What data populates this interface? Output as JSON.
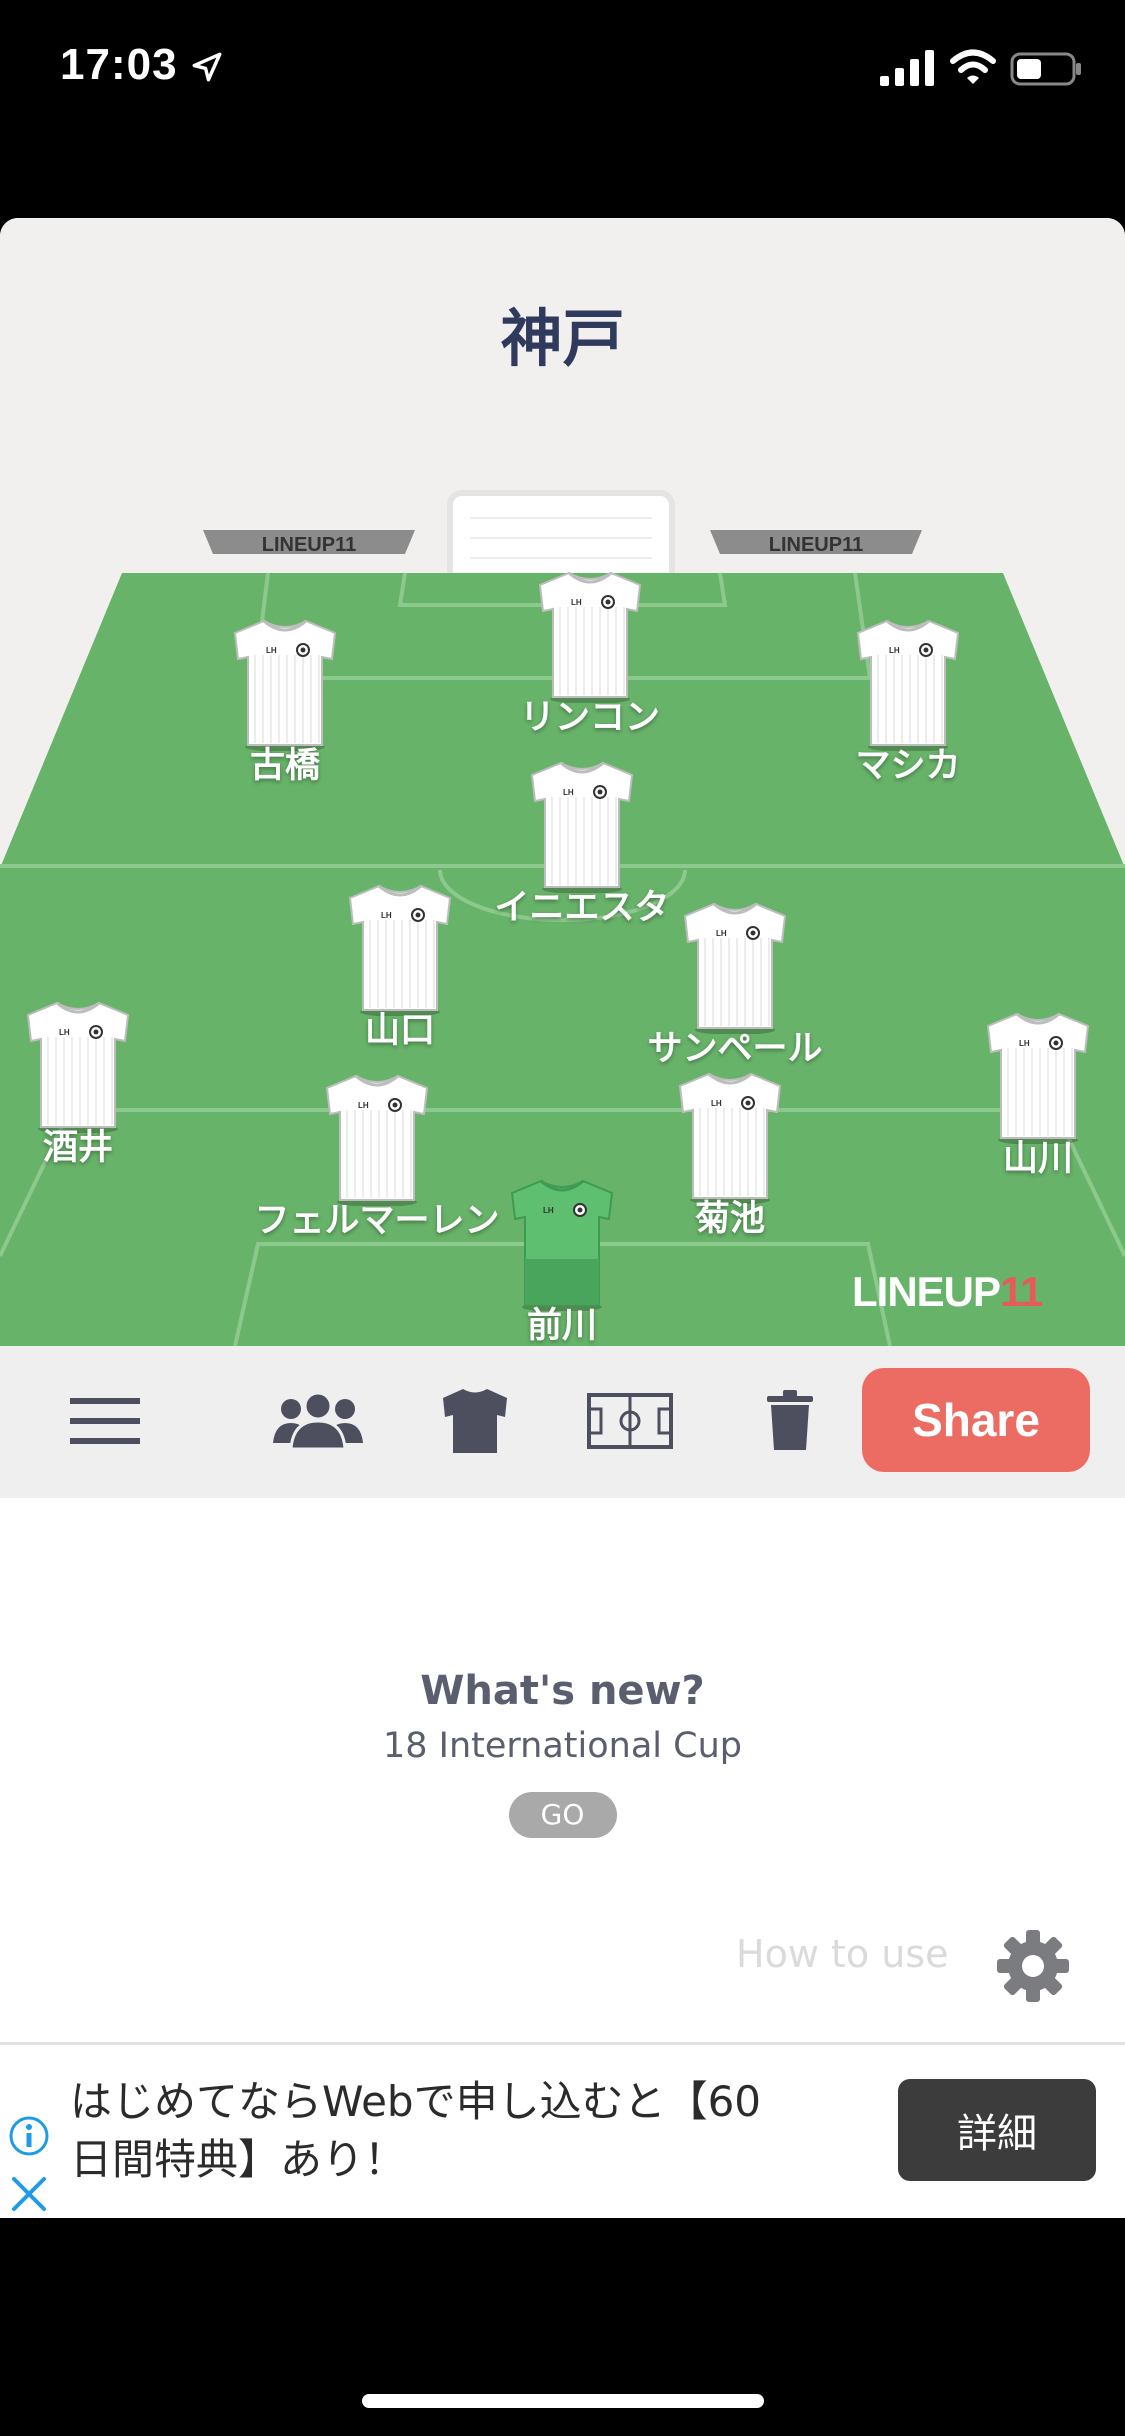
{
  "status_bar": {
    "time": "17:03"
  },
  "team": {
    "title": "神戸"
  },
  "banners": {
    "text": "LINEUP11"
  },
  "watermark": {
    "part1": "LINEUP",
    "part2": "11"
  },
  "players": [
    {
      "name": "リンコン",
      "kit": "outfield"
    },
    {
      "name": "古橋",
      "kit": "outfield"
    },
    {
      "name": "マシカ",
      "kit": "outfield"
    },
    {
      "name": "イニエスタ",
      "kit": "outfield"
    },
    {
      "name": "山口",
      "kit": "outfield"
    },
    {
      "name": "サンペール",
      "kit": "outfield"
    },
    {
      "name": "酒井",
      "kit": "outfield"
    },
    {
      "name": "山川",
      "kit": "outfield"
    },
    {
      "name": "フェルマーレン",
      "kit": "outfield"
    },
    {
      "name": "菊池",
      "kit": "outfield"
    },
    {
      "name": "前川",
      "kit": "goalkeeper"
    }
  ],
  "toolbar": {
    "menu_icon": "hamburger-icon",
    "players_icon": "group-icon",
    "kit_icon": "shirt-icon",
    "field_icon": "pitch-icon",
    "delete_icon": "trash-icon",
    "share_label": "Share"
  },
  "news": {
    "title": "What's new?",
    "subtitle": "18 International Cup",
    "go_label": "GO"
  },
  "help": {
    "label": "How to use"
  },
  "ad": {
    "text_line1": "はじめてならWebで申し込むと【60",
    "text_line2": "日間特典】あり！",
    "button_label": "詳細"
  },
  "colors": {
    "pitch": "#68b36a",
    "team_title": "#2f3a5c",
    "share": "#ec6b63",
    "goalkeeper_kit": "#5dbf6f"
  }
}
